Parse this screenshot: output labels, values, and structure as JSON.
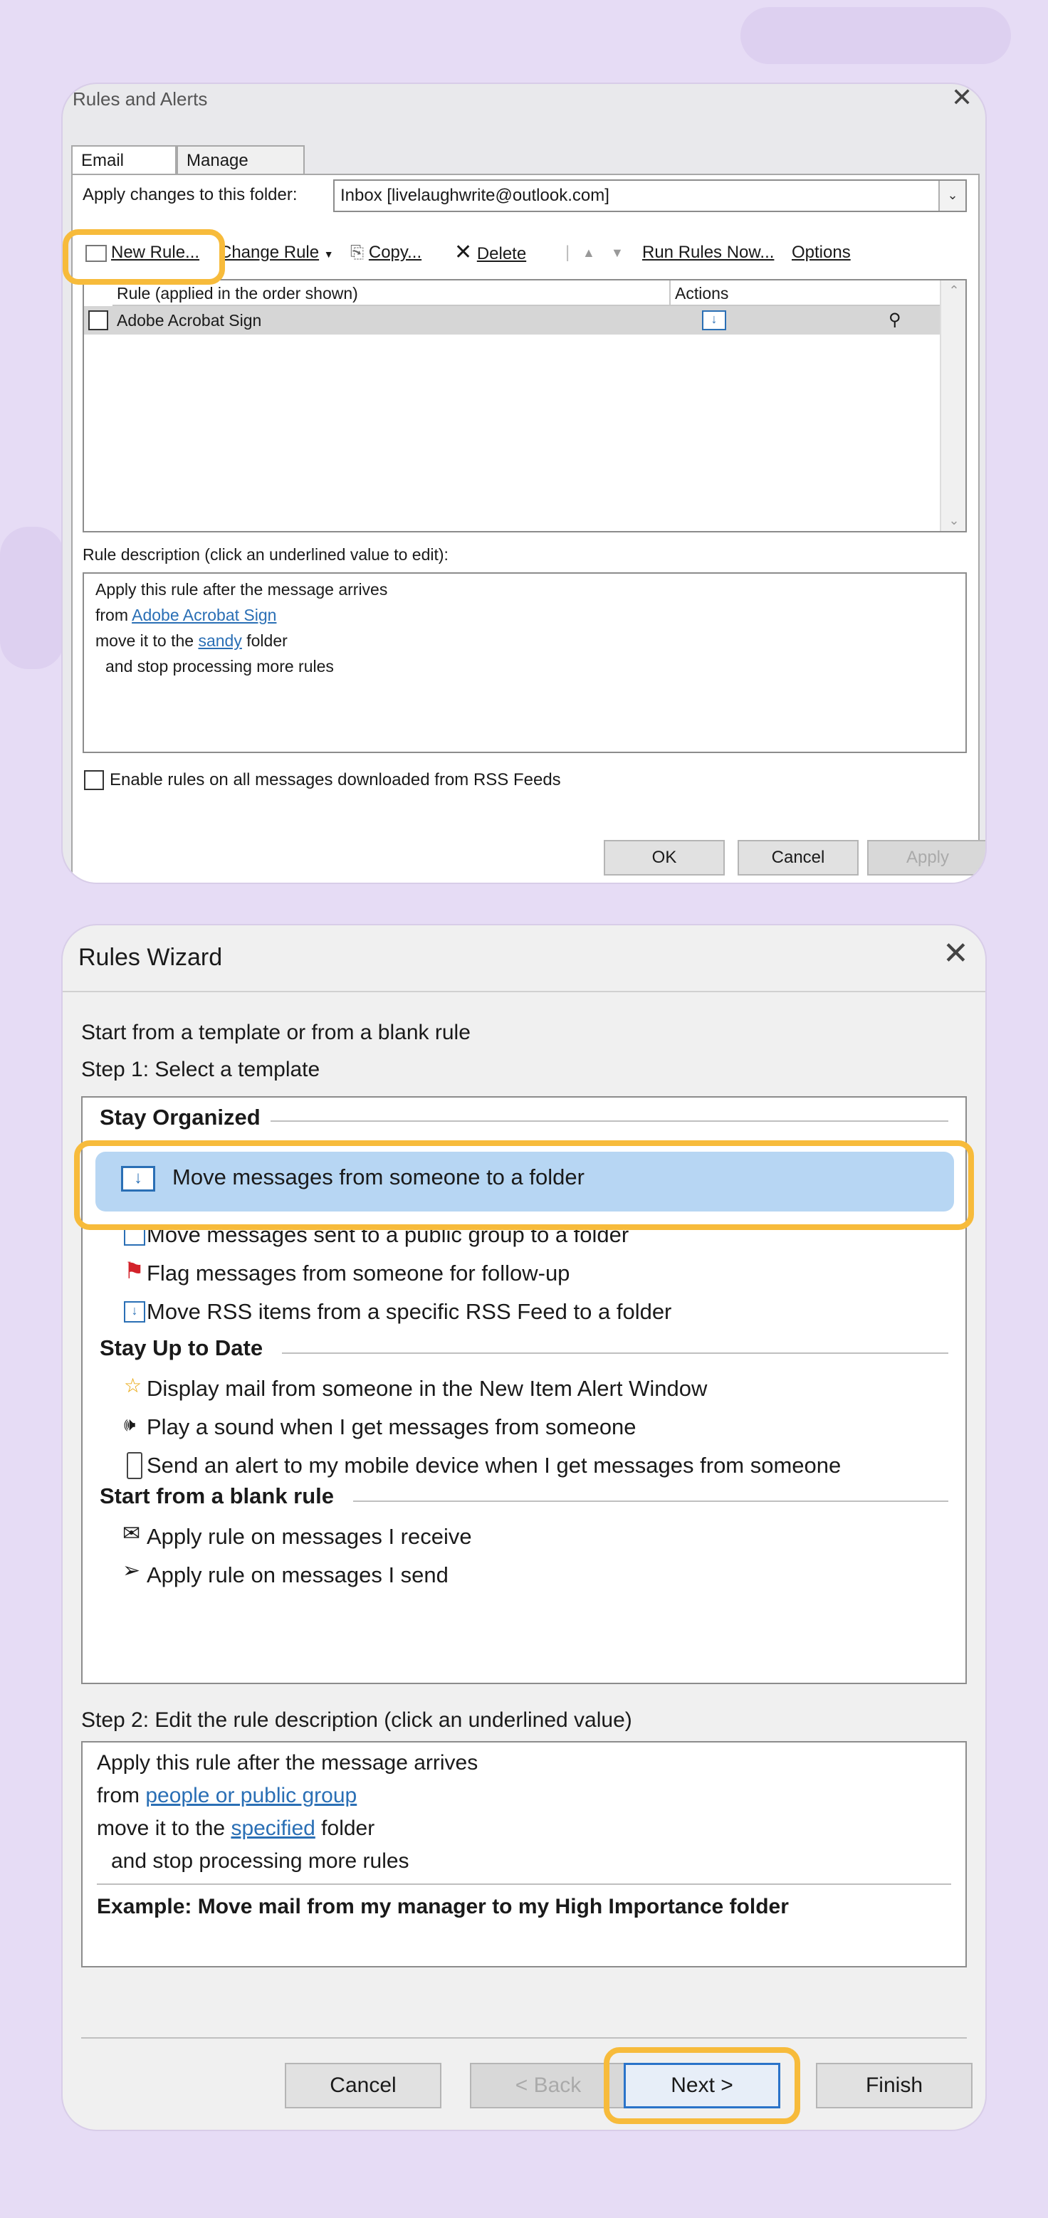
{
  "rules_alerts": {
    "title": "Rules and Alerts",
    "tabs": [
      "Email Rules",
      "Manage Alerts"
    ],
    "apply_label": "Apply changes to this folder:",
    "folder": "Inbox [livelaughwrite@outlook.com]",
    "toolbar": {
      "new_rule": "New Rule...",
      "change_rule": "Change Rule",
      "copy": "Copy...",
      "delete": "Delete",
      "run_rules": "Run Rules Now...",
      "options": "Options"
    },
    "columns": [
      "Rule (applied in the order shown)",
      "Actions"
    ],
    "rules": [
      {
        "name": "Adobe Acrobat Sign"
      }
    ],
    "desc_label": "Rule description (click an underlined value to edit):",
    "description": {
      "line1": "Apply this rule after the message arrives",
      "from_prefix": "from ",
      "from_link": "Adobe Acrobat Sign",
      "move_prefix": "move it to the ",
      "move_link": "sandy",
      "move_suffix": " folder",
      "line4": "and stop processing more rules"
    },
    "rss_checkbox": "Enable rules on all messages downloaded from RSS Feeds",
    "buttons": {
      "ok": "OK",
      "cancel": "Cancel",
      "apply": "Apply"
    }
  },
  "wizard": {
    "title": "Rules Wizard",
    "intro": "Start from a template or from a blank rule",
    "step1": "Step 1: Select a template",
    "groups": [
      {
        "name": "Stay Organized",
        "items": [
          {
            "label": "Move messages from someone to a folder",
            "icon": "move-folder-icon",
            "selected": true
          },
          {
            "label": "Move messages sent to a public group to a folder",
            "icon": "move-folder-icon"
          },
          {
            "label": "Flag messages from someone for follow-up",
            "icon": "flag-icon"
          },
          {
            "label": "Move RSS items from a specific RSS Feed to a folder",
            "icon": "move-folder-icon"
          }
        ]
      },
      {
        "name": "Stay Up to Date",
        "items": [
          {
            "label": "Display mail from someone in the New Item Alert Window",
            "icon": "star-mail-icon"
          },
          {
            "label": "Play a sound when I get messages from someone",
            "icon": "speaker-icon"
          },
          {
            "label": "Send an alert to my mobile device when I get messages from someone",
            "icon": "mobile-icon"
          }
        ]
      },
      {
        "name": "Start from a blank rule",
        "items": [
          {
            "label": "Apply rule on messages I receive",
            "icon": "envelope-icon"
          },
          {
            "label": "Apply rule on messages I send",
            "icon": "send-icon"
          }
        ]
      }
    ],
    "step2": "Step 2: Edit the rule description (click an underlined value)",
    "description": {
      "line1": "Apply this rule after the message arrives",
      "from_prefix": "from ",
      "from_link": "people or public group",
      "move_prefix": "move it to the ",
      "move_link": "specified",
      "move_suffix": " folder",
      "line4": "and stop processing more rules",
      "example": "Example: Move mail from my manager to my High Importance folder"
    },
    "buttons": {
      "cancel": "Cancel",
      "back": "< Back",
      "next": "Next >",
      "finish": "Finish"
    }
  },
  "colors": {
    "highlight": "#f7bb3b",
    "selection": "#b7d6f3",
    "link": "#2a6fb5",
    "background": "#e6dcf5"
  }
}
